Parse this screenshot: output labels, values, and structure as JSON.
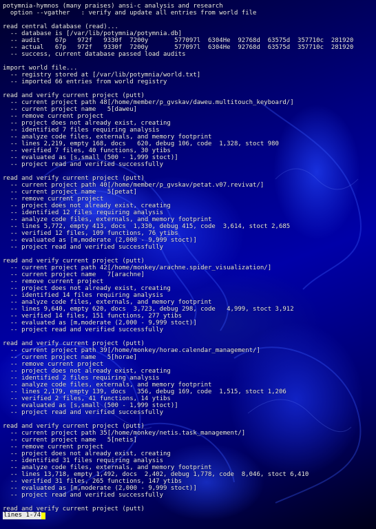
{
  "terminal": {
    "lines": [
      "potymnia-hymnos (many praises) ansi-c analysis and research",
      "  option --vgather   : verify and update all entries from world file",
      "",
      "read central database (read)...",
      "  -- database is [/var/lib/potymnia/potymnia.db]",
      "  -- audit    67p   972f   9330f  7200y       577097l  6304He  92768d  63575d  357710c  281920",
      "  -- actual   67p   972f   9330f  7200y       577097l  6304He  92768d  63575d  357710c  281920",
      "  -- success, current database passed load audits",
      "",
      "import world file...",
      "  -- registry stored at [/var/lib/potymnia/world.txt]",
      "  -- imported 66 entries from world registry",
      "",
      "read and verify current project (putt)",
      "  -- current project path 48[/home/member/p_gvskav/daweu.multitouch_keyboard/]",
      "  -- current project name   5[daweu]",
      "  -- remove current project",
      "  -- project does not already exist, creating",
      "  -- identified 7 files requiring analysis",
      "  -- analyze code files, externals, and memory footprint",
      "  -- lines 2,219, empty 168, docs   620, debug 106, code  1,328, stoct 980",
      "  -- verified 7 files, 40 functions, 30 ytibs",
      "  -- evaluated as [s,small (500 - 1,999 stoct)]",
      "  -- project read and verified successfully",
      "",
      "read and verify current project (putt)",
      "  -- current project path 40[/home/member/p_gvskav/petat.v07.revivat/]",
      "  -- current project name   5[petat]",
      "  -- remove current project",
      "  -- project does not already exist, creating",
      "  -- identified 12 files requiring analysis",
      "  -- analyze code files, externals, and memory footprint",
      "  -- lines 5,772, empty 413, docs  1,330, debug 415, code  3,614, stoct 2,685",
      "  -- verified 12 files, 109 functions, 76 ytibs",
      "  -- evaluated as [m,moderate (2,000 - 9,999 stoct)]",
      "  -- project read and verified successfully",
      "",
      "read and verify current project (putt)",
      "  -- current project path 42[/home/monkey/arachne.spider_visualization/]",
      "  -- current project name   7[arachne]",
      "  -- remove current project",
      "  -- project does not already exist, creating",
      "  -- identified 14 files requiring analysis",
      "  -- analyze code files, externals, and memory footprint",
      "  -- lines 9,640, empty 620, docs  3,723, debug 298, code   4,999, stoct 3,912",
      "  -- verified 14 files, 151 functions, 277 ytibs",
      "  -- evaluated as [m,moderate (2,000 - 9,999 stoct)]",
      "  -- project read and verified successfully",
      "",
      "read and verify current project (putt)",
      "  -- current project path 39[/home/monkey/horae.calendar_management/]",
      "  -- current project name   5[horae]",
      "  -- remove current project",
      "  -- project does not already exist, creating",
      "  -- identified 2 files requiring analysis",
      "  -- analyze code files, externals, and memory footprint",
      "  -- lines 2,179, empty 139, docs   356, debug 169, code  1,515, stoct 1,206",
      "  -- verified 2 files, 41 functions, 14 ytibs",
      "  -- evaluated as [s,small (500 - 1,999 stoct)]",
      "  -- project read and verified successfully",
      "",
      "read and verify current project (putt)",
      "  -- current project path 35[/home/monkey/netis.task_management/]",
      "  -- current project name   5[netis]",
      "  -- remove current project",
      "  -- project does not already exist, creating",
      "  -- identified 31 files requiring analysis",
      "  -- analyze code files, externals, and memory footprint",
      "  -- lines 13,718, empty 1,492, docs  2,402, debug 1,778, code  8,046, stoct 6,410",
      "  -- verified 31 files, 265 functions, 147 ytibs",
      "  -- evaluated as [m,moderate (2,000 - 9,999 stoct)]",
      "  -- project read and verified successfully",
      "",
      "read and verify current project (putt)"
    ],
    "status": "lines 1-74",
    "colors": {
      "text": "#e8e8f0",
      "status_bg": "#e8e8e8",
      "cursor": "#ffff00",
      "wallpaper_base": "#0000a8"
    }
  }
}
